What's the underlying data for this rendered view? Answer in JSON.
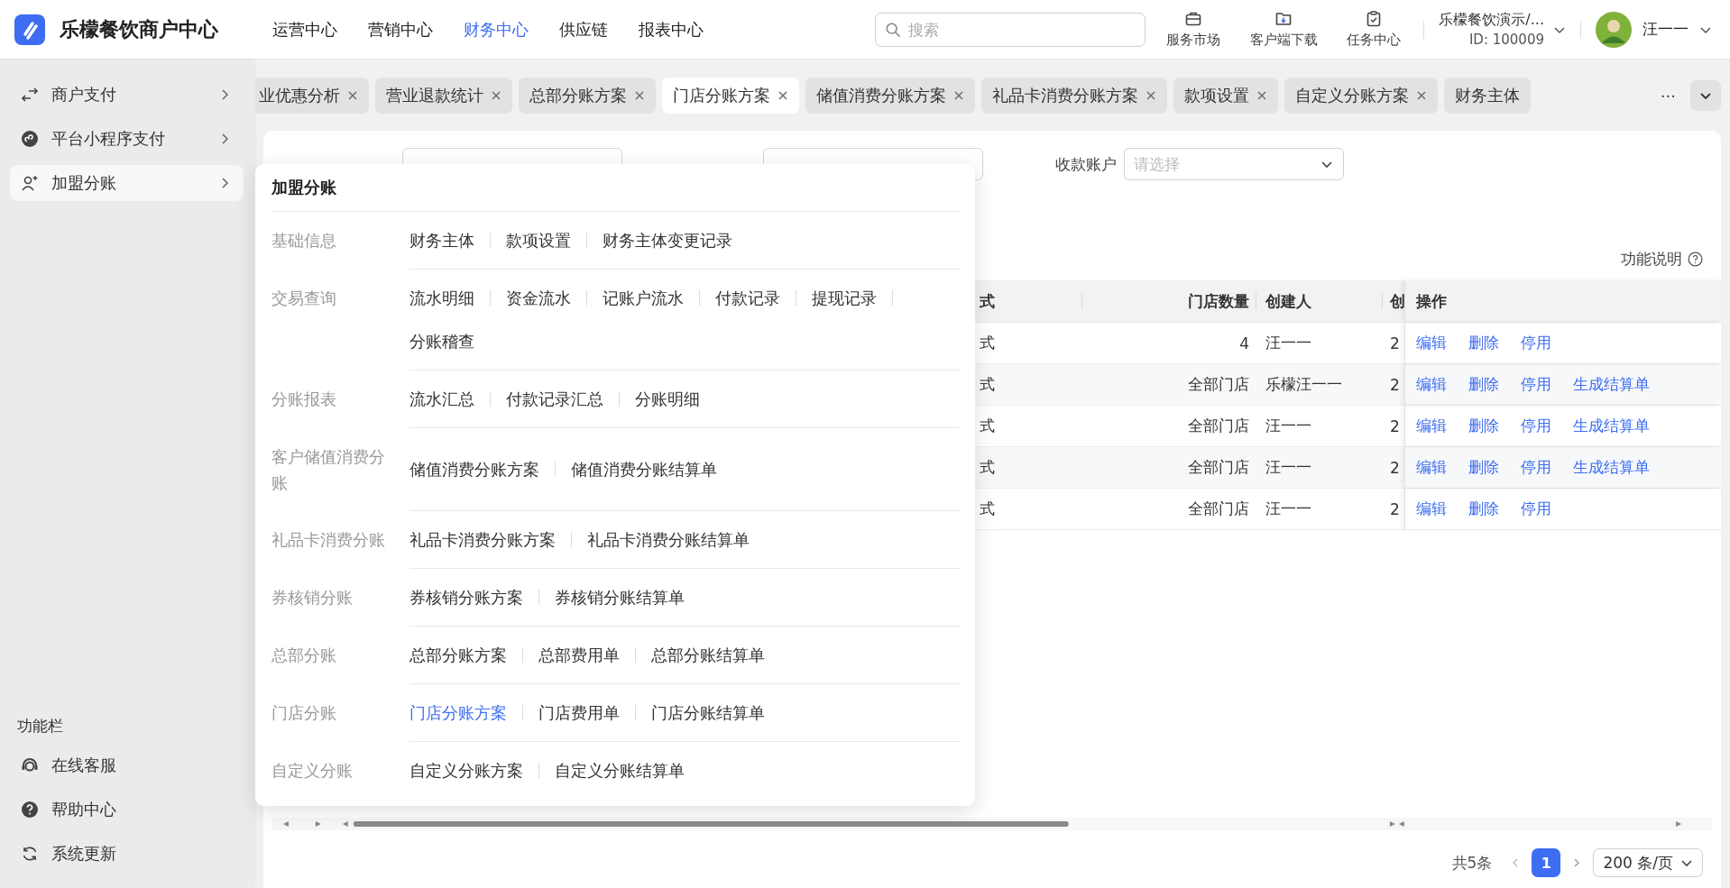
{
  "header": {
    "logo_text": "乐檬餐饮商户中心",
    "nav": [
      {
        "label": "运营中心",
        "selected": false
      },
      {
        "label": "营销中心",
        "selected": false
      },
      {
        "label": "财务中心",
        "selected": true
      },
      {
        "label": "供应链",
        "selected": false
      },
      {
        "label": "报表中心",
        "selected": false
      }
    ],
    "search": {
      "placeholder": "搜索"
    },
    "tools": [
      {
        "label": "服务市场",
        "kind": "briefcase"
      },
      {
        "label": "客户端下载",
        "kind": "download"
      },
      {
        "label": "任务中心",
        "kind": "clipboard"
      }
    ],
    "account": {
      "name": "乐檬餐饮演示/...",
      "id": "ID: 100009"
    },
    "user": {
      "name": "汪一一"
    }
  },
  "sidebar": {
    "items": [
      {
        "label": "商户支付",
        "kind": "exchange",
        "selected": false
      },
      {
        "label": "平台小程序支付",
        "kind": "miniapp",
        "selected": false
      },
      {
        "label": "加盟分账",
        "kind": "adduser",
        "selected": true
      }
    ],
    "footer_title": "功能栏",
    "footer_items": [
      {
        "label": "在线客服",
        "kind": "headset"
      },
      {
        "label": "帮助中心",
        "kind": "help"
      },
      {
        "label": "系统更新",
        "kind": "refresh"
      }
    ]
  },
  "tabs": [
    {
      "label": "业优惠分析",
      "selected": false,
      "closable": true
    },
    {
      "label": "营业退款统计",
      "selected": false,
      "closable": true
    },
    {
      "label": "总部分账方案",
      "selected": false,
      "closable": true
    },
    {
      "label": "门店分账方案",
      "selected": true,
      "closable": true
    },
    {
      "label": "储值消费分账方案",
      "selected": false,
      "closable": true
    },
    {
      "label": "礼品卡消费分账方案",
      "selected": false,
      "closable": true
    },
    {
      "label": "款项设置",
      "selected": false,
      "closable": true
    },
    {
      "label": "自定义分账方案",
      "selected": false,
      "closable": true
    },
    {
      "label": "财务主体",
      "selected": false,
      "closable": false
    }
  ],
  "tabs_more": "···",
  "filters": [
    {
      "kind": "input"
    },
    {
      "kind": "select"
    },
    {
      "label": "收款账户",
      "kind": "select",
      "placeholder": "请选择"
    }
  ],
  "help_link": "功能说明",
  "table": {
    "columns": [
      "式",
      "门店数量",
      "创建人",
      "创",
      "操作"
    ],
    "rows": [
      {
        "cells": [
          "式",
          "4",
          "汪一一",
          "2"
        ],
        "actions": [
          "编辑",
          "删除",
          "停用"
        ]
      },
      {
        "cells": [
          "式",
          "全部门店",
          "乐檬汪一一",
          "2"
        ],
        "actions": [
          "编辑",
          "删除",
          "停用",
          "生成结算单"
        ]
      },
      {
        "cells": [
          "式",
          "全部门店",
          "汪一一",
          "2"
        ],
        "actions": [
          "编辑",
          "删除",
          "停用",
          "生成结算单"
        ]
      },
      {
        "cells": [
          "式",
          "全部门店",
          "汪一一",
          "2"
        ],
        "actions": [
          "编辑",
          "删除",
          "停用",
          "生成结算单"
        ]
      },
      {
        "cells": [
          "式",
          "全部门店",
          "汪一一",
          "2"
        ],
        "actions": [
          "编辑",
          "删除",
          "停用"
        ]
      }
    ]
  },
  "pagination": {
    "total": "共5条",
    "pages": [
      {
        "label": "1",
        "selected": true
      }
    ],
    "page_size": "200 条/页"
  },
  "menu": {
    "title": "加盟分账",
    "groups": [
      {
        "label": "基础信息",
        "links": [
          {
            "label": "财务主体",
            "selected": false
          },
          {
            "label": "款项设置",
            "selected": false
          },
          {
            "label": "财务主体变更记录",
            "selected": false
          }
        ]
      },
      {
        "label": "交易查询",
        "links": [
          {
            "label": "流水明细",
            "selected": false
          },
          {
            "label": "资金流水",
            "selected": false
          },
          {
            "label": "记账户流水",
            "selected": false
          },
          {
            "label": "付款记录",
            "selected": false
          },
          {
            "label": "提现记录",
            "selected": false
          },
          {
            "label": "分账稽查",
            "selected": false
          }
        ]
      },
      {
        "label": "分账报表",
        "links": [
          {
            "label": "流水汇总",
            "selected": false
          },
          {
            "label": "付款记录汇总",
            "selected": false
          },
          {
            "label": "分账明细",
            "selected": false
          }
        ]
      },
      {
        "label": "客户储值消费分账",
        "links": [
          {
            "label": "储值消费分账方案",
            "selected": false
          },
          {
            "label": "储值消费分账结算单",
            "selected": false
          }
        ]
      },
      {
        "label": "礼品卡消费分账",
        "links": [
          {
            "label": "礼品卡消费分账方案",
            "selected": false
          },
          {
            "label": "礼品卡消费分账结算单",
            "selected": false
          }
        ]
      },
      {
        "label": "券核销分账",
        "links": [
          {
            "label": "券核销分账方案",
            "selected": false
          },
          {
            "label": "券核销分账结算单",
            "selected": false
          }
        ]
      },
      {
        "label": "总部分账",
        "links": [
          {
            "label": "总部分账方案",
            "selected": false
          },
          {
            "label": "总部费用单",
            "selected": false
          },
          {
            "label": "总部分账结算单",
            "selected": false
          }
        ]
      },
      {
        "label": "门店分账",
        "links": [
          {
            "label": "门店分账方案",
            "selected": true
          },
          {
            "label": "门店费用单",
            "selected": false
          },
          {
            "label": "门店分账结算单",
            "selected": false
          }
        ]
      },
      {
        "label": "自定义分账",
        "links": [
          {
            "label": "自定义分账方案",
            "selected": false
          },
          {
            "label": "自定义分账结算单",
            "selected": false
          }
        ]
      }
    ]
  }
}
